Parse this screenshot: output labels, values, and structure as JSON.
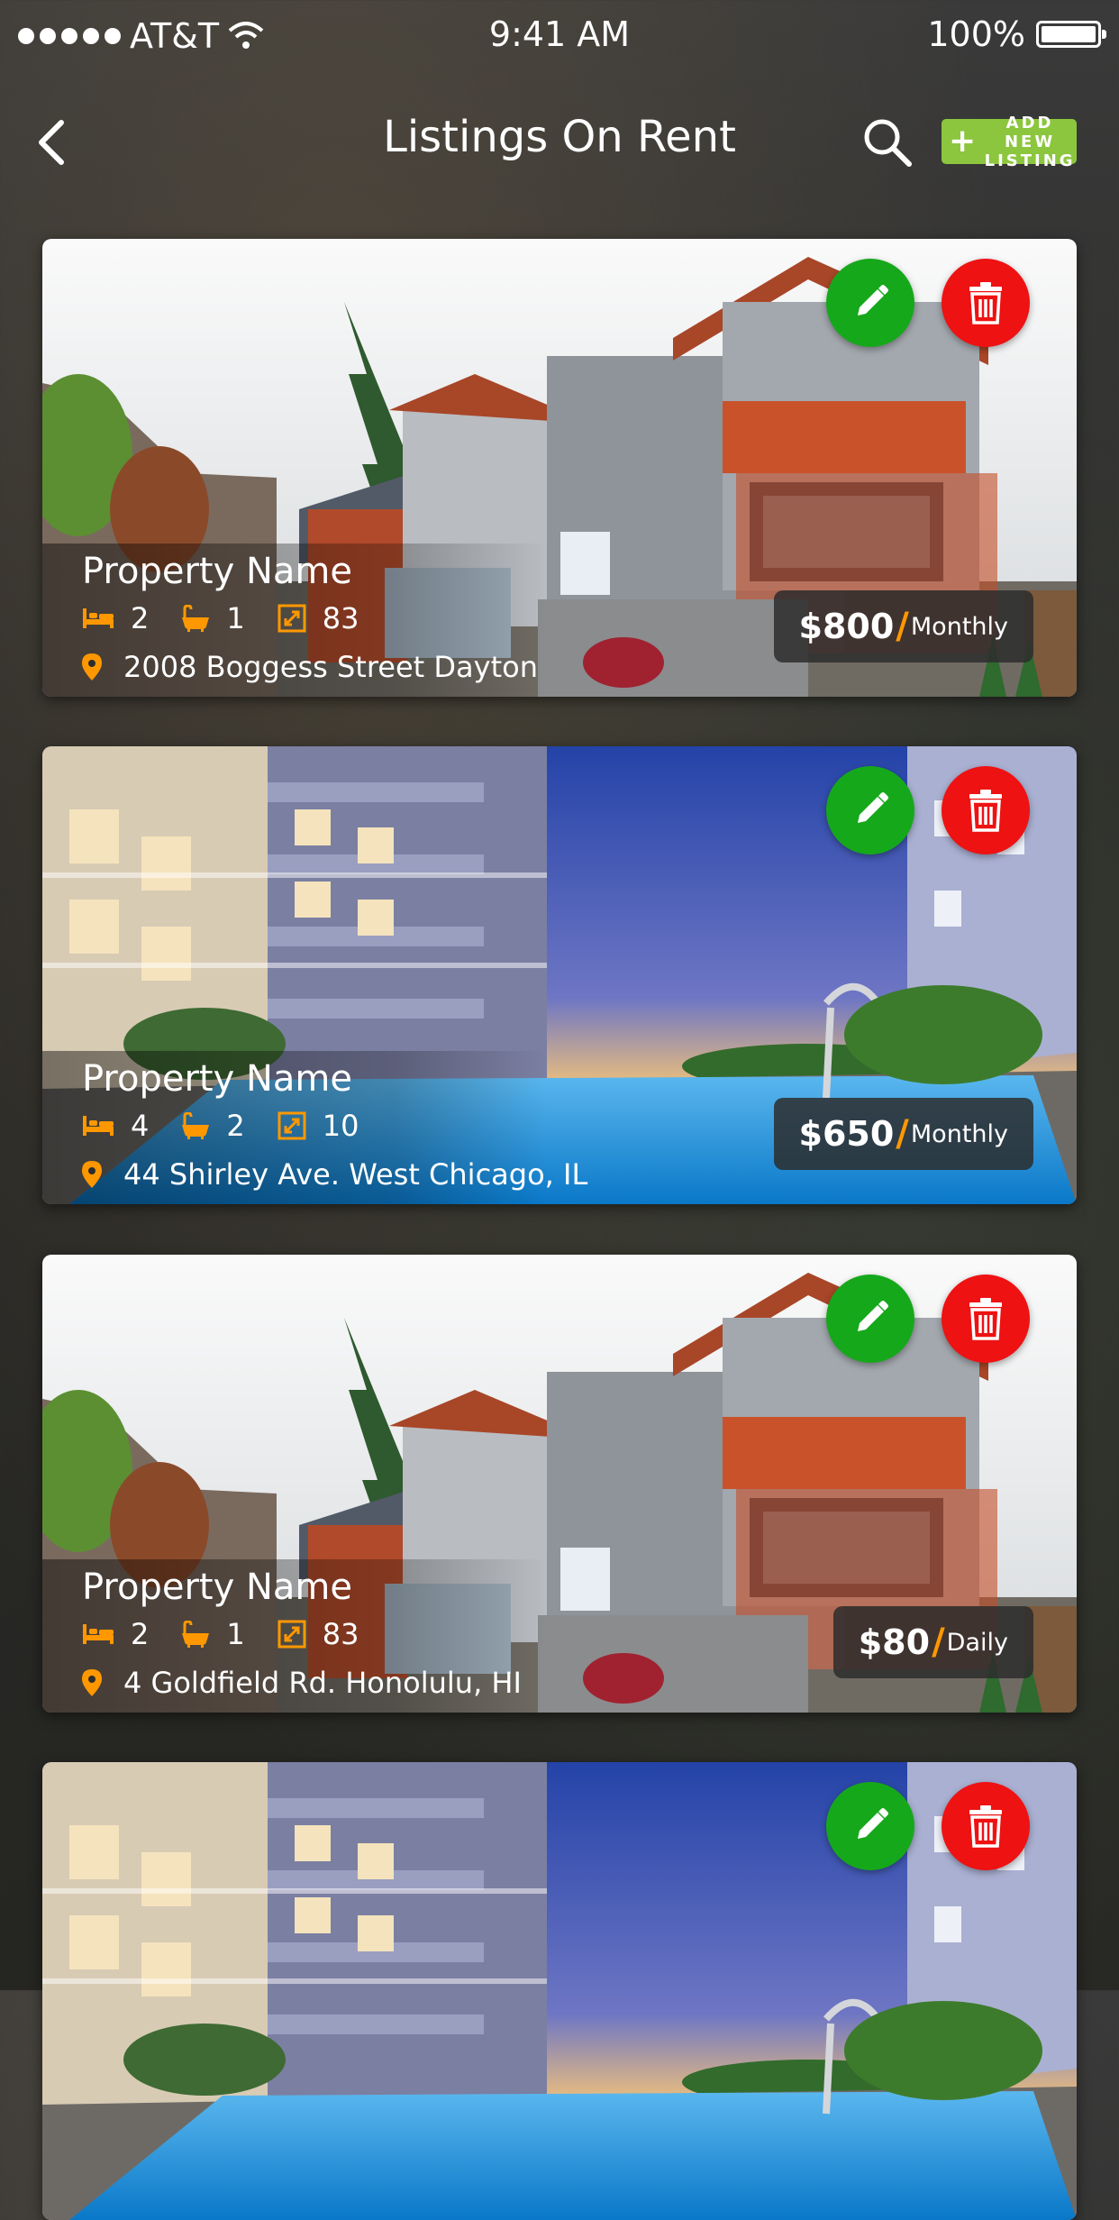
{
  "status": {
    "carrier": "AT&T",
    "time": "9:41 AM",
    "battery": "100%"
  },
  "header": {
    "title": "Listings On Rent",
    "add_button_line1": "ADD NEW",
    "add_button_line2": "LISTING"
  },
  "colors": {
    "accent": "#ff9800",
    "edit": "#16a81b",
    "delete": "#ee1212",
    "add": "#8cc63e"
  },
  "listings": [
    {
      "name": "Property Name",
      "beds": "2",
      "baths": "1",
      "area": "83",
      "address": "2008 Boggess Street Dayton",
      "price": "$800",
      "period": "Monthly",
      "image": "house"
    },
    {
      "name": "Property Name",
      "beds": "4",
      "baths": "2",
      "area": "10",
      "address": "44 Shirley Ave. West Chicago, IL",
      "price": "$650",
      "period": "Monthly",
      "image": "pool"
    },
    {
      "name": "Property Name",
      "beds": "2",
      "baths": "1",
      "area": "83",
      "address": "4 Goldfield Rd. Honolulu, HI",
      "price": "$80",
      "period": "Daily",
      "image": "house"
    },
    {
      "image": "pool"
    }
  ]
}
